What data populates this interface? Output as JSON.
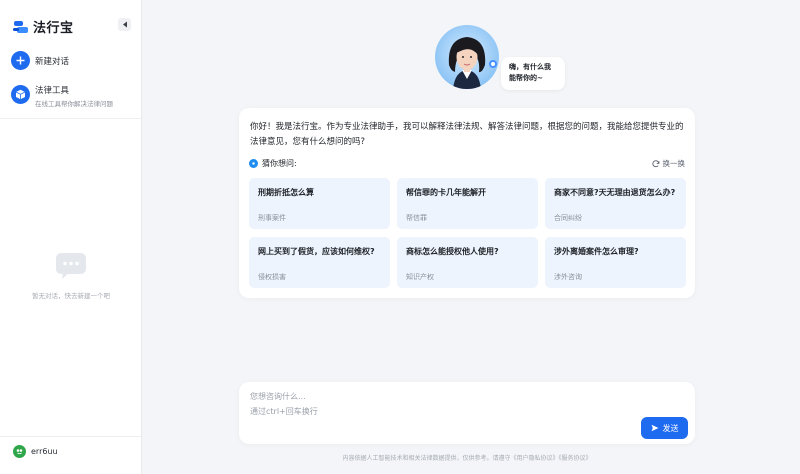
{
  "app": {
    "name": "法行宝"
  },
  "sidebar": {
    "new_chat_label": "新建对话",
    "tool": {
      "title": "法律工具",
      "subtitle": "在线工具帮你解决法律问题"
    },
    "empty_text": "暂无对话，快去新建一个吧",
    "user_name": "err6uu"
  },
  "hero": {
    "greeting_line1": "嗨，有什么我",
    "greeting_line2": "能帮你的~"
  },
  "intro": "你好！我是法行宝。作为专业法律助手，我可以解释法律法规、解答法律问题，根据您的问题，我能给您提供专业的法律意见，您有什么想问的吗?",
  "suggestions": {
    "label": "猜你想问:",
    "refresh_label": "换一换",
    "items": [
      {
        "title": "刑期折抵怎么算",
        "tag": "刑事案件"
      },
      {
        "title": "帮信罪的卡几年能解开",
        "tag": "帮信罪"
      },
      {
        "title": "商家不同意?天无理由退货怎么办?",
        "tag": "合同纠纷"
      },
      {
        "title": "网上买到了假货，应该如何维权?",
        "tag": "侵权损害"
      },
      {
        "title": "商标怎么能授权他人使用?",
        "tag": "知识产权"
      },
      {
        "title": "涉外离婚案件怎么审理?",
        "tag": "涉外咨询"
      }
    ]
  },
  "input": {
    "placeholder": "您想咨询什么...",
    "hint": "通过ctrl+回车换行",
    "send_label": "发送"
  },
  "footer": "内容依据人工智能技术和相关法律数据提供，仅供参考。请遵守《用户隐私协议》《服务协议》",
  "colors": {
    "accent": "#1f6bf0",
    "card_bg": "#eef4fd",
    "page_bg": "#f3f5f8"
  }
}
